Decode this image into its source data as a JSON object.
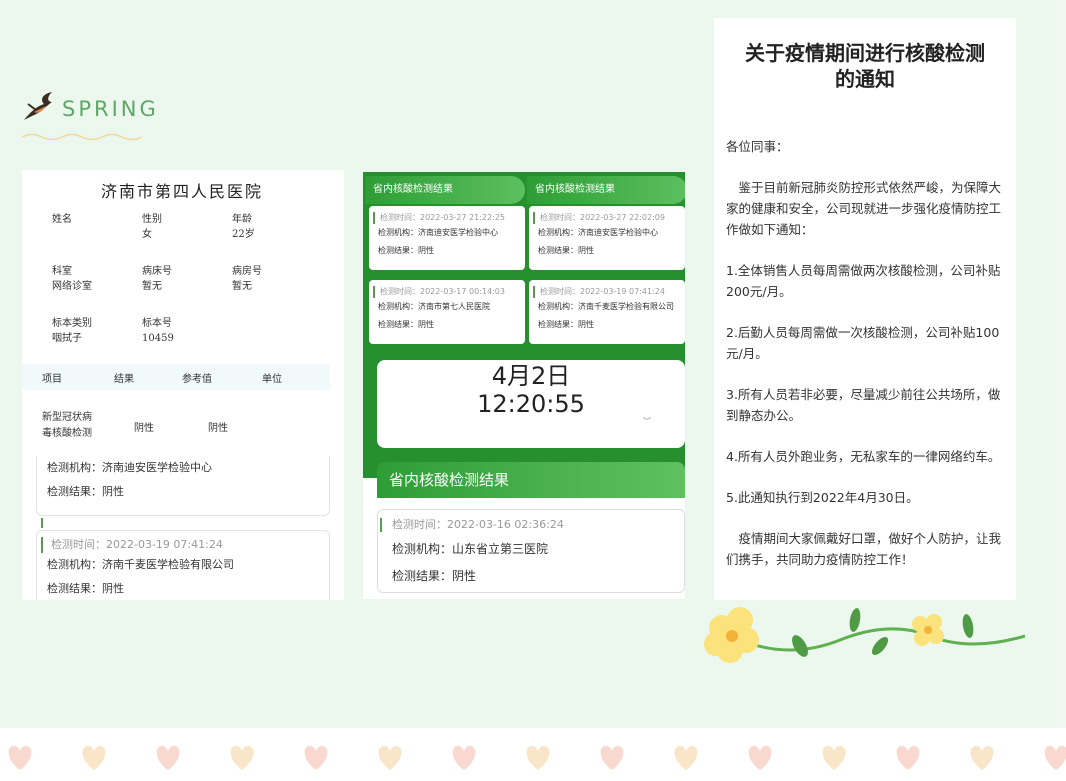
{
  "logo": {
    "text": "SPRING",
    "icon": "swallow-icon"
  },
  "report": {
    "hospital": "济南市第四人民医院",
    "fields": [
      {
        "label": "姓名",
        "value": ""
      },
      {
        "label": "性别",
        "value": "女"
      },
      {
        "label": "年龄",
        "value": "22岁"
      },
      {
        "label": "科室",
        "value": "网络诊室"
      },
      {
        "label": "病床号",
        "value": "暂无"
      },
      {
        "label": "病房号",
        "value": "暂无"
      },
      {
        "label": "标本类别",
        "value": "咽拭子"
      },
      {
        "label": "标本号",
        "value": "10459"
      }
    ],
    "table_headers": [
      "项目",
      "结果",
      "参考值",
      "单位"
    ],
    "table_row": {
      "item_line1": "新型冠状病",
      "item_line2": "毒核酸检测",
      "result": "阴性",
      "reference": "阴性",
      "unit": ""
    }
  },
  "p1_cards": [
    {
      "org": "检测机构：济南迪安医学检验中心",
      "result": "检测结果：阴性"
    },
    {
      "time": "检测时间：2022-03-19 07:41:24",
      "org": "检测机构：济南千麦医学检验有限公司",
      "result": "检测结果：阴性"
    }
  ],
  "phone": {
    "header": "省内核酸检测结果",
    "mini_cards": [
      {
        "time": "检测时间：2022-03-27 21:22:25",
        "org": "检测机构：济南迪安医学检验中心",
        "result": "检测结果：阴性"
      },
      {
        "time": "检测时间：2022-03-27 22:02:09",
        "org": "检测机构：济南迪安医学检验中心",
        "result": "检测结果：阴性"
      },
      {
        "time": "检测时间：2022-03-17 00:14:03",
        "org": "检测机构：济南市第七人民医院",
        "result": "检测结果：阴性"
      },
      {
        "time": "检测时间：2022-03-19 07:41:24",
        "org": "检测机构：济南千麦医学检验有限公司",
        "result": "检测结果：阴性"
      }
    ],
    "clock_date": "4月2日",
    "clock_time": "12:20:55",
    "band_title": "省内核酸检测结果",
    "big_card": {
      "time": "检测时间：2022-03-16 02:36:24",
      "org": "检测机构：山东省立第三医院",
      "result": "检测结果：阴性"
    }
  },
  "notice": {
    "title_line1": "关于疫情期间进行核酸检测",
    "title_line2": "的通知",
    "greeting": "各位同事：",
    "intro": "　鉴于目前新冠肺炎防控形式依然严峻，为保障大家的健康和安全，公司现就进一步强化疫情防控工作做如下通知：",
    "items": [
      "1.全体销售人员每周需做两次核酸检测，公司补贴200元/月。",
      "2.后勤人员每周需做一次核酸检测，公司补贴100元/月。",
      "3.所有人员若非必要，尽量减少前往公共场所，做到静态办公。",
      "4.所有人员外跑业务，无私家车的一律网络约车。",
      "5.此通知执行到2022年4月30日。"
    ],
    "closing": "　疫情期间大家佩戴好口罩，做好个人防护，让我们携手，共同助力疫情防控工作！"
  },
  "colors": {
    "green": "#27902e",
    "accent": "#5fa766",
    "heart": "#f7c6c6"
  }
}
